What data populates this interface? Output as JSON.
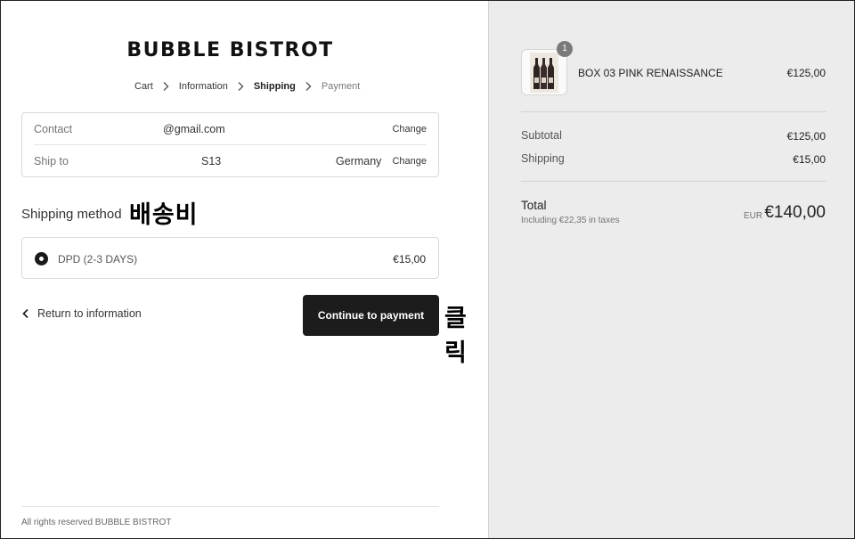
{
  "store": {
    "name": "BUBBLE BISTROT"
  },
  "breadcrumb": [
    {
      "label": "Cart",
      "state": "done"
    },
    {
      "label": "Information",
      "state": "done"
    },
    {
      "label": "Shipping",
      "state": "current"
    },
    {
      "label": "Payment",
      "state": "upcoming"
    }
  ],
  "contact": {
    "label": "Contact",
    "value": "@gmail.com",
    "change_label": "Change"
  },
  "ship_to": {
    "label": "Ship to",
    "address": "S13",
    "country": "Germany",
    "change_label": "Change"
  },
  "shipping_method": {
    "title": "Shipping method",
    "options": [
      {
        "name": "DPD (2-3 DAYS)",
        "price": "€15,00",
        "selected": true
      }
    ]
  },
  "annotations": {
    "shipping_note": "배송비",
    "click_note": "클릭"
  },
  "actions": {
    "return_label": "Return to information",
    "continue_label": "Continue to payment"
  },
  "footer": {
    "text": "All rights reserved BUBBLE BISTROT"
  },
  "summary": {
    "product": {
      "name": "BOX 03 PINK RENAISSANCE",
      "price": "€125,00",
      "quantity": "1"
    },
    "subtotal": {
      "label": "Subtotal",
      "value": "€125,00"
    },
    "shipping": {
      "label": "Shipping",
      "value": "€15,00"
    },
    "total": {
      "label": "Total",
      "tax_note": "Including €22,35 in taxes",
      "currency": "EUR",
      "value": "€140,00"
    }
  },
  "colors": {
    "primary_button": "#1c1c1c",
    "sidebar_bg": "#ececec",
    "border": "#d9d9d9"
  },
  "icons": {
    "breadcrumb_separator": "chevron-right-icon",
    "back": "chevron-left-icon",
    "radio": "radio-selected-icon"
  }
}
